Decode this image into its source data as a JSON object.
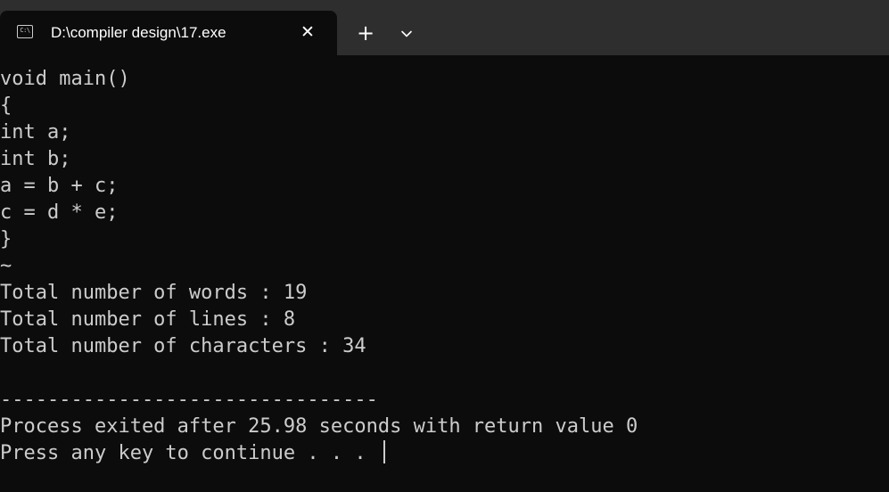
{
  "window": {
    "tab_icon_text": "C:\\",
    "tab_title": "D:\\compiler design\\17.exe",
    "close_glyph": "✕",
    "new_tab_glyph": "+",
    "dropdown_icon": "chevron-down-icon"
  },
  "terminal": {
    "lines": [
      "void main()",
      "{",
      "int a;",
      "int b;",
      "a = b + c;",
      "c = d * e;",
      "}",
      "~",
      "Total number of words : 19",
      "Total number of lines : 8",
      "Total number of characters : 34",
      "",
      "--------------------------------",
      "Process exited after 25.98 seconds with return value 0",
      "Press any key to continue . . . "
    ]
  },
  "colors": {
    "background": "#0c0c0c",
    "titlebar": "#2e2e2e",
    "text": "#cccccc"
  }
}
